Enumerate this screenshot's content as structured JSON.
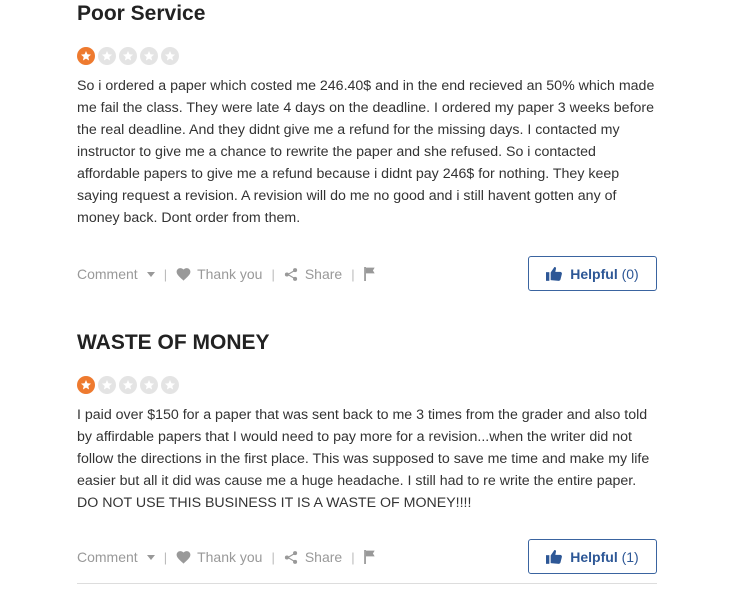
{
  "reviews": [
    {
      "title": "Poor Service",
      "rating": 1,
      "max_rating": 5,
      "body": "So i ordered a paper which costed me 246.40$ and in the end recieved an 50% which made me fail the class. They were late 4 days on the deadline. I ordered my paper 3 weeks before the real deadline. And they didnt give me a refund for the missing days. I contacted my instructor to give me a chance to rewrite the paper and she refused. So i contacted affordable papers to give me a refund because i didnt pay 246$ for nothing. They keep saying request a revision. A revision will do me no good and i still havent gotten any of money back. Dont order from them.",
      "comment_label": "Comment",
      "thank_label": "Thank you",
      "share_label": "Share",
      "helpful_label": "Helpful",
      "helpful_count": "(0)"
    },
    {
      "title": "WASTE OF MONEY",
      "rating": 1,
      "max_rating": 5,
      "body": "I paid over $150 for a paper that was sent back to me 3 times from the grader and also told by affirdable papers that I would need to pay more for a revision...when the writer did not follow the directions in the first place. This was supposed to save me time and make my life easier but all it did was cause me a huge headache. I still had to re write the entire paper. DO NOT USE THIS BUSINESS IT IS A WASTE OF MONEY!!!!",
      "comment_label": "Comment",
      "thank_label": "Thank you",
      "share_label": "Share",
      "helpful_label": "Helpful",
      "helpful_count": "(1)"
    }
  ],
  "colors": {
    "star_filled": "#ee7a2f",
    "star_empty": "#e4e4e4",
    "helpful_blue": "#2d5796"
  }
}
